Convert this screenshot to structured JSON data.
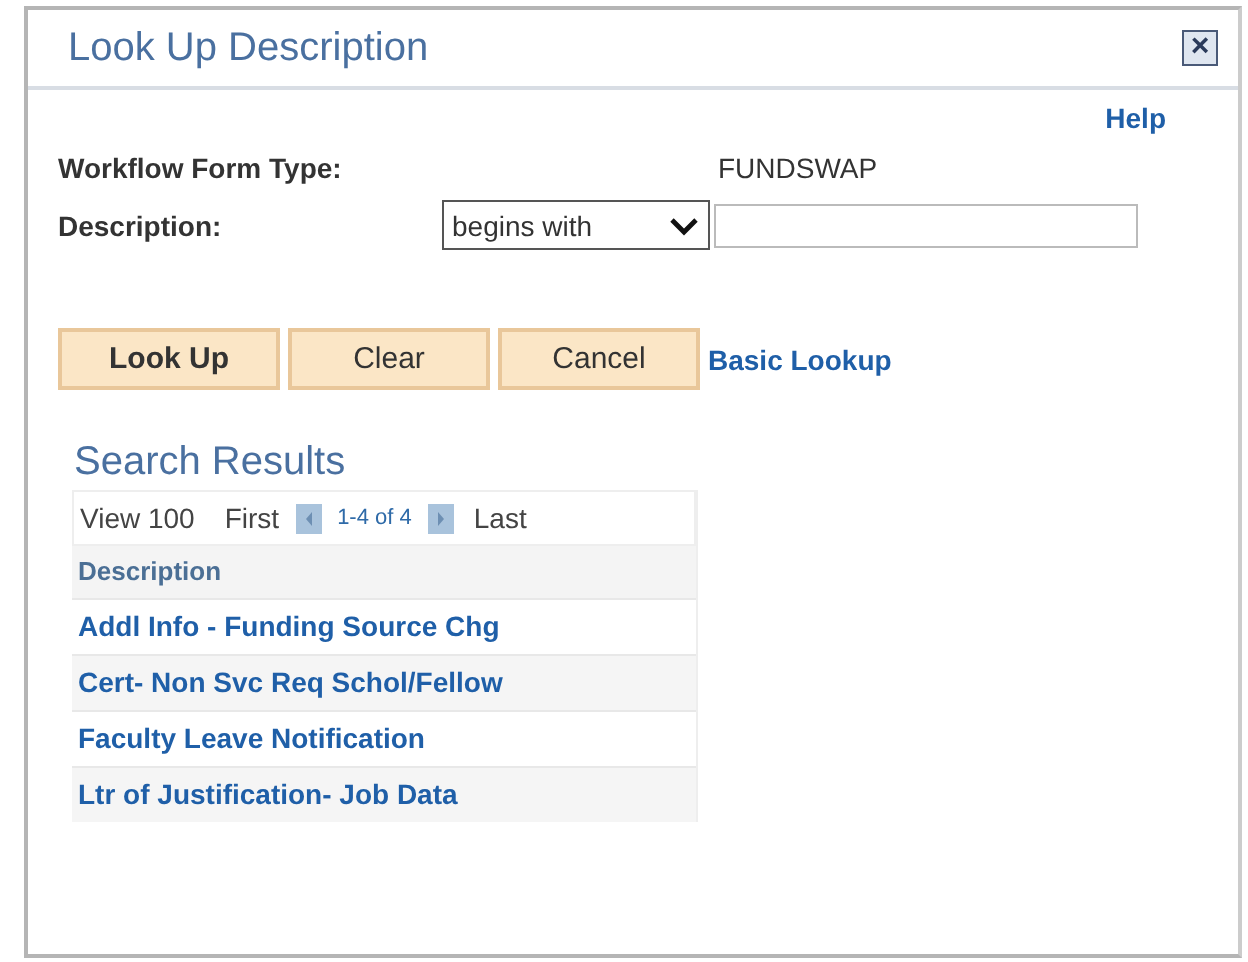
{
  "window": {
    "title": "Look Up Description",
    "close": "×"
  },
  "help": "Help",
  "fields": [
    {
      "label": "Workflow Form Type:",
      "kind": "value",
      "value": "FUNDSWAP"
    },
    {
      "label": "Description:",
      "kind": "search",
      "operator": "begins with"
    }
  ],
  "buttons": [
    {
      "label": "Look Up"
    },
    {
      "label": "Clear"
    },
    {
      "label": "Cancel"
    }
  ],
  "basic_lookup": "Basic Lookup",
  "results": {
    "title": "Search Results",
    "view": "View 100",
    "first": "First",
    "range": "1-4 of 4",
    "last": "Last",
    "column": "Description",
    "rows": [
      "Addl Info - Funding Source Chg",
      "Cert- Non Svc Req Schol/Fellow",
      "Faculty Leave Notification",
      "Ltr of Justification- Job Data"
    ]
  }
}
